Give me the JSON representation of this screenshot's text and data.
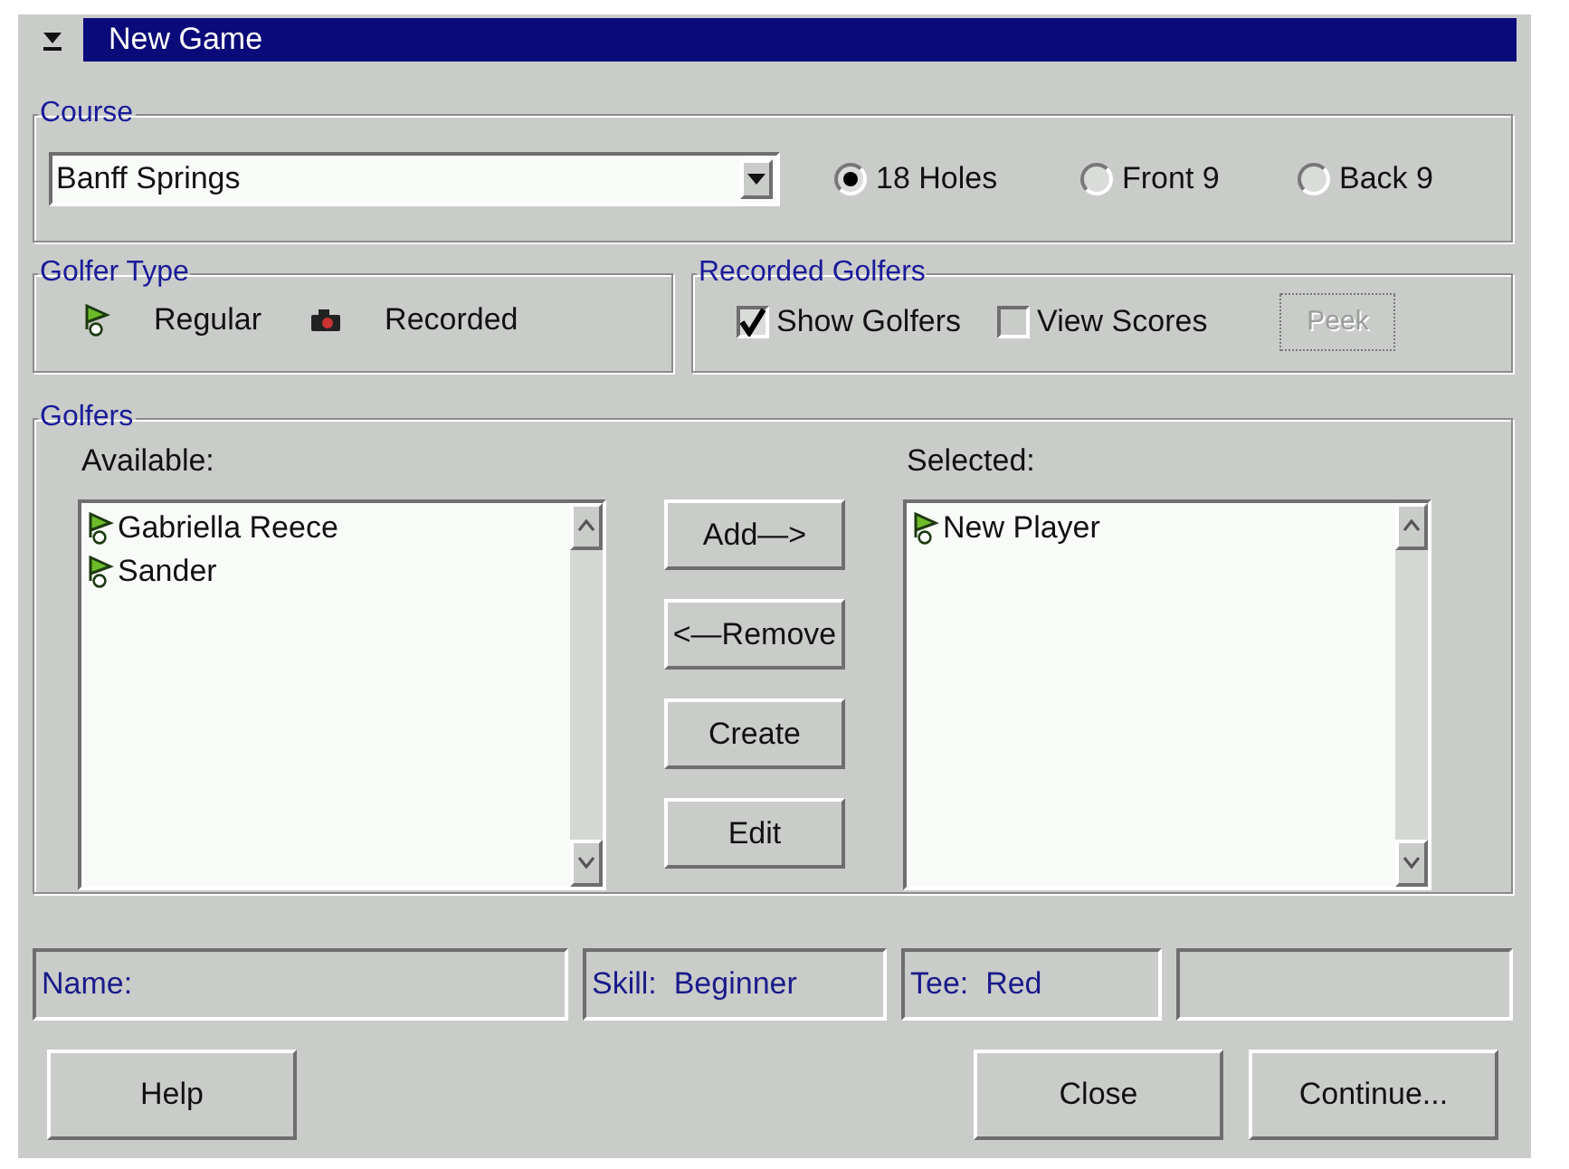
{
  "window": {
    "title": "New Game"
  },
  "course": {
    "label": "Course",
    "value": "Banff Springs",
    "holes": [
      {
        "label": "18 Holes",
        "selected": true
      },
      {
        "label": "Front 9",
        "selected": false
      },
      {
        "label": "Back 9",
        "selected": false
      }
    ]
  },
  "golfer_type": {
    "label": "Golfer Type",
    "types": [
      {
        "kind": "regular",
        "label": "Regular"
      },
      {
        "kind": "recorded",
        "label": "Recorded"
      }
    ]
  },
  "recorded_golfers": {
    "label": "Recorded Golfers",
    "checkboxes": [
      {
        "label": "Show Golfers",
        "checked": true
      },
      {
        "label": "View Scores",
        "checked": false
      }
    ],
    "peek_button": {
      "label": "Peek",
      "disabled": true
    }
  },
  "golfers": {
    "label": "Golfers",
    "available": {
      "label": "Available:",
      "items": [
        {
          "kind": "regular",
          "name": "Gabriella Reece"
        },
        {
          "kind": "regular",
          "name": "Sander"
        }
      ]
    },
    "actions": [
      {
        "label": "Add—>"
      },
      {
        "label": "<—Remove"
      },
      {
        "label": "Create"
      },
      {
        "label": "Edit"
      }
    ],
    "selected": {
      "label": "Selected:",
      "items": [
        {
          "kind": "regular",
          "name": "New Player"
        }
      ]
    }
  },
  "status_bar": [
    "Name:",
    "Skill:  Beginner",
    "Tee:  Red"
  ],
  "buttons": [
    {
      "label": "Help"
    },
    {
      "label": "Close"
    },
    {
      "label": "Continue..."
    }
  ]
}
